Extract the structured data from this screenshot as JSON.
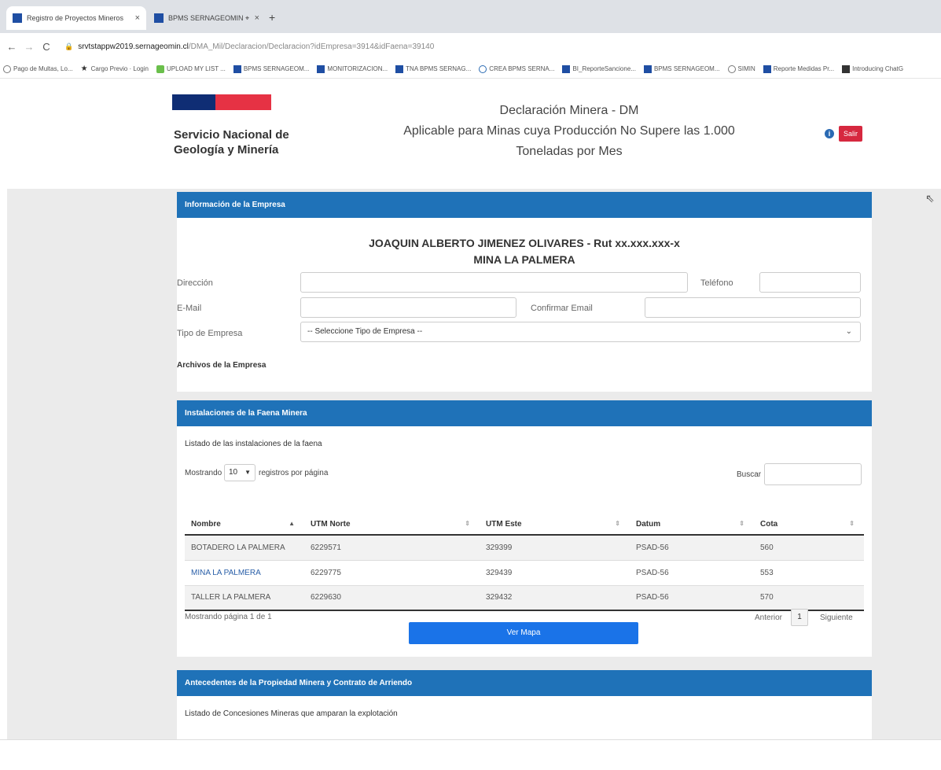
{
  "browser": {
    "tabs": [
      {
        "label": "Registro de Proyectos Mineros",
        "close": "×"
      },
      {
        "label": "BPMS SERNAGEOMIN ⌖",
        "close": "×"
      }
    ],
    "new_tab": "+",
    "nav": {
      "back": "←",
      "forward": "→",
      "reload": "C"
    },
    "url": {
      "host": "srvtstappw2019.sernageomin.cl",
      "path": "/DMA_Mil/Declaracion/Declaracion?idEmpresa=3914&idFaena=39140"
    },
    "bookmarks": [
      "Pago de Multas, Lo...",
      "Cargo Previo · Login",
      "UPLOAD MY LIST ...",
      "BPMS SERNAGEOM...",
      "MONITORIZACION...",
      "TNA BPMS SERNAG...",
      "CREA BPMS SERNA...",
      "BI_ReporteSancione...",
      "BPMS SERNAGEOM...",
      "SIMIN",
      "Reporte Medidas Pr...",
      "Introducing ChatG"
    ]
  },
  "header": {
    "org_name": "Servicio Nacional de Geología y Minería",
    "title_line1": "Declaración Minera - DM",
    "title_line2": "Aplicable para Minas cuya Producción No Supere las 1.000",
    "title_line3": "Toneladas por Mes",
    "info": "i",
    "exit_button": "Salir",
    "colors": {
      "logo_blue": "#0f2d74",
      "logo_red": "#e63244",
      "panel_blue": "#1f72b8",
      "button_blue": "#1a73e8",
      "exit_red": "#d6283f"
    }
  },
  "empresa_panel": {
    "title": "Información de la Empresa",
    "owner_line": "JOAQUIN ALBERTO JIMENEZ OLIVARES - Rut xx.xxx.xxx-x",
    "mine_line": "MINA LA PALMERA",
    "direccion_label": "Dirección",
    "telefono_label": "Teléfono",
    "email_label": "E-Mail",
    "confirm_email_label": "Confirmar Email",
    "tipo_label": "Tipo de Empresa",
    "tipo_value": "-- Seleccione Tipo de Empresa --",
    "archivos_label": "Archivos de la Empresa"
  },
  "instalaciones_panel": {
    "title": "Instalaciones de la Faena Minera",
    "list_title": "Listado de las instalaciones de la faena",
    "show_prefix": "Mostrando",
    "page_length": "10",
    "show_suffix": "registros por página",
    "search_label": "Buscar",
    "columns": [
      "Nombre",
      "UTM Norte",
      "UTM Este",
      "Datum",
      "Cota"
    ],
    "rows": [
      {
        "nombre": "BOTADERO LA PALMERA",
        "norte": "6229571",
        "este": "329399",
        "datum": "PSAD-56",
        "cota": "560"
      },
      {
        "nombre": "MINA LA PALMERA",
        "norte": "6229775",
        "este": "329439",
        "datum": "PSAD-56",
        "cota": "553"
      },
      {
        "nombre": "TALLER LA PALMERA",
        "norte": "6229630",
        "este": "329432",
        "datum": "PSAD-56",
        "cota": "570"
      }
    ],
    "page_info": "Mostrando página 1 de 1",
    "prev": "Anterior",
    "current_page": "1",
    "next": "Siguiente",
    "map_button": "Ver Mapa"
  },
  "antecedentes_panel": {
    "title": "Antecedentes de la Propiedad Minera y Contrato de Arriendo",
    "list_title": "Listado de Concesiones Mineras que amparan la explotación"
  }
}
